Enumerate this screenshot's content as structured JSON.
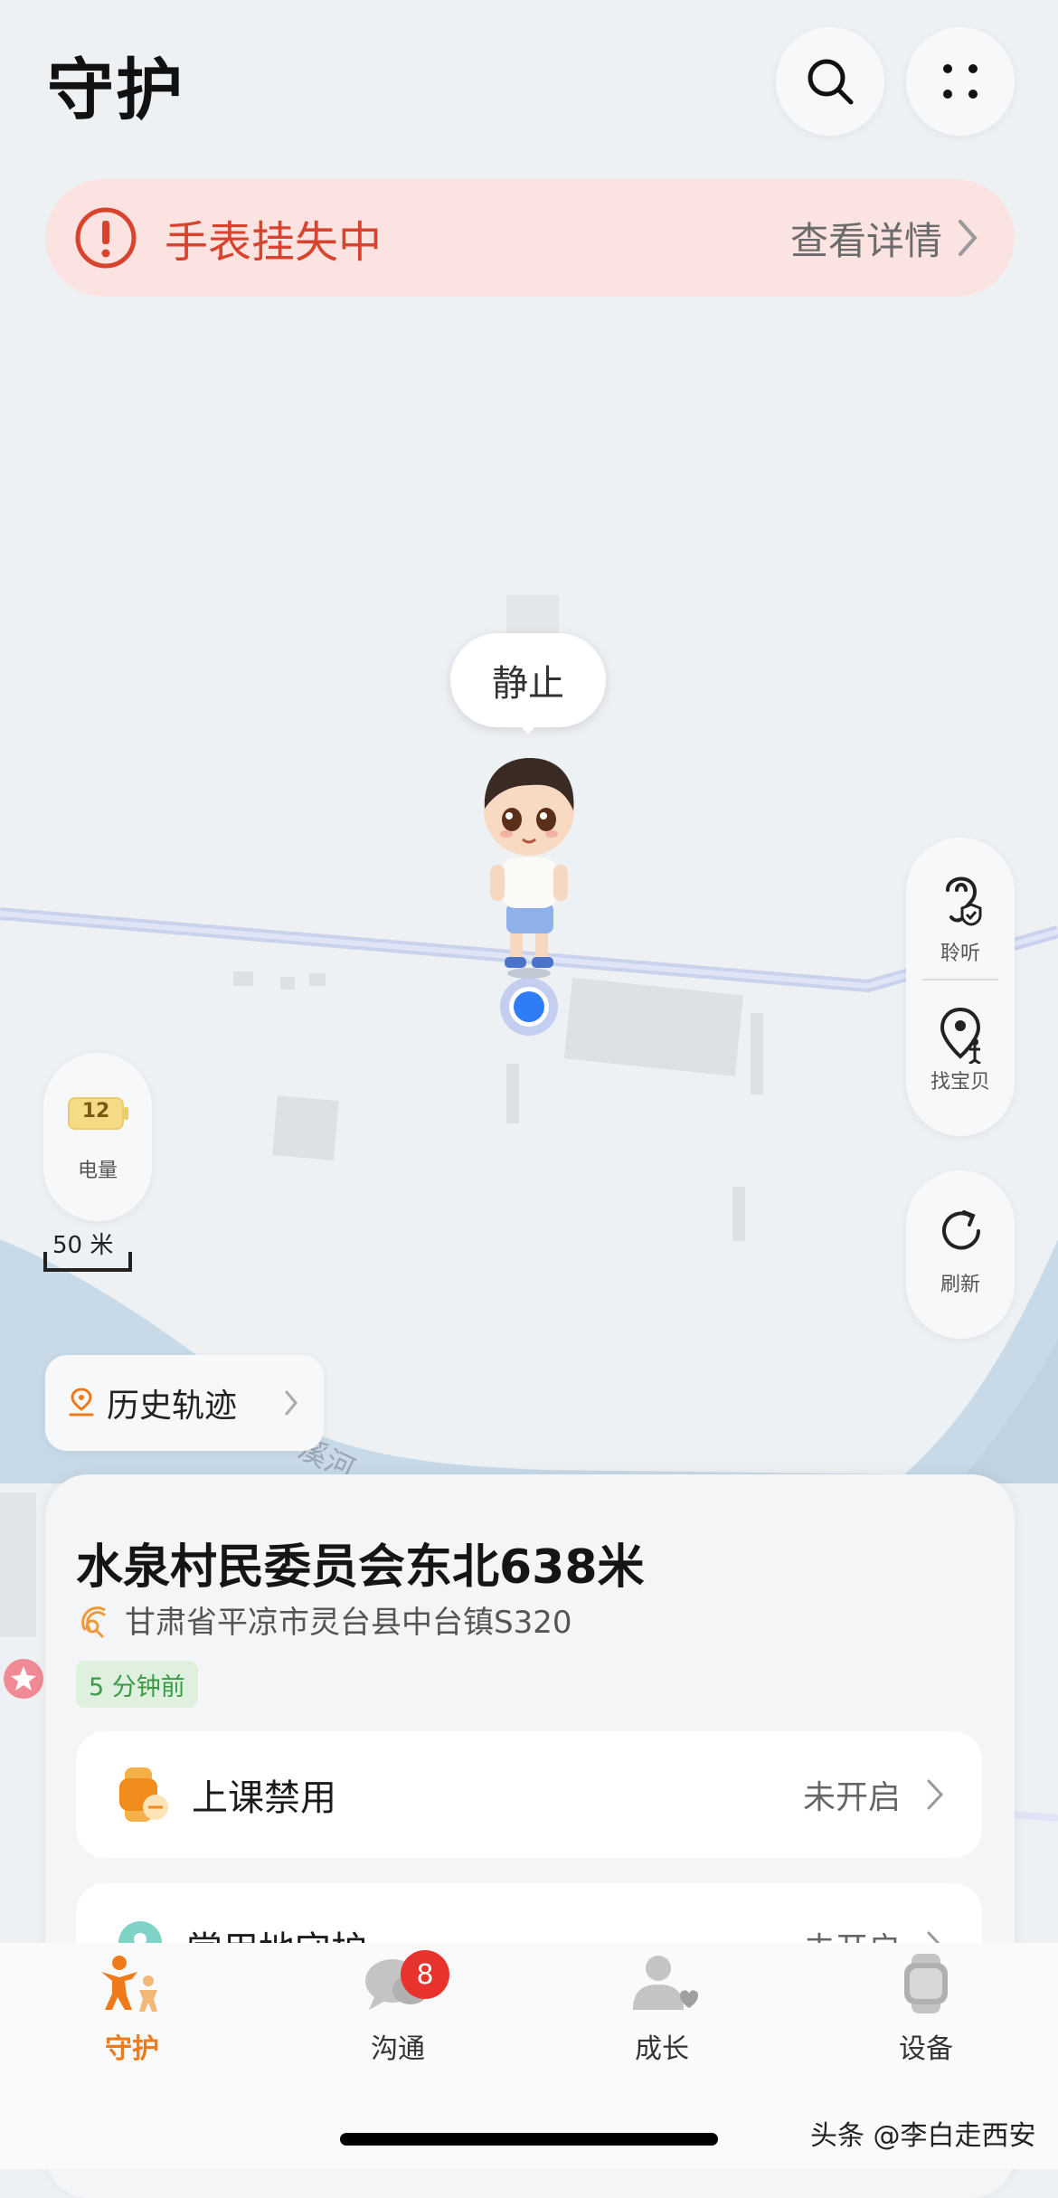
{
  "header": {
    "title": "守护"
  },
  "alert": {
    "text": "手表挂失中",
    "detail_label": "查看详情"
  },
  "map": {
    "status_bubble": "静止",
    "scale_label": "50 米",
    "road_label": "溪河"
  },
  "battery": {
    "level": "12",
    "label": "电量"
  },
  "side_actions": {
    "listen_label": "聆听",
    "find_label": "找宝贝",
    "refresh_label": "刷新"
  },
  "history": {
    "label": "历史轨迹"
  },
  "location": {
    "title": "水泉村民委员会东北638米",
    "address": "甘肃省平凉市灵台县中台镇S320",
    "time_ago": "5 分钟前"
  },
  "features": [
    {
      "label": "上课禁用",
      "status": "未开启"
    },
    {
      "label": "常用地守护",
      "status": "未开启"
    }
  ],
  "nav": {
    "items": [
      {
        "label": "守护",
        "active": true
      },
      {
        "label": "沟通",
        "badge": "8"
      },
      {
        "label": "成长"
      },
      {
        "label": "设备"
      }
    ]
  },
  "watermark": "头条 @李白走西安",
  "colors": {
    "accent": "#ef7a1a",
    "alert_red": "#d8432e",
    "location_blue": "#2f7cf6",
    "badge_red": "#e8322d"
  }
}
